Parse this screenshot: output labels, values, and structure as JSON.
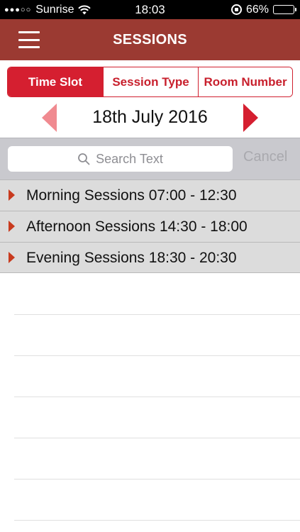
{
  "statusbar": {
    "signal_dots": "●●●○○",
    "carrier": "Sunrise",
    "time": "18:03",
    "battery_percent": "66%",
    "battery_level": 0.66
  },
  "navbar": {
    "title": "SESSIONS",
    "menu_icon": "hamburger-menu-icon"
  },
  "segments": [
    {
      "label": "Time Slot",
      "active": true
    },
    {
      "label": "Session Type",
      "active": false
    },
    {
      "label": "Room Number",
      "active": false
    }
  ],
  "date": {
    "label": "18th July 2016"
  },
  "search": {
    "placeholder": "Search Text",
    "cancel_label": "Cancel"
  },
  "sessions": [
    {
      "label": "Morning Sessions 07:00 - 12:30"
    },
    {
      "label": "Afternoon Sessions 14:30 - 18:00"
    },
    {
      "label": "Evening Sessions 18:30 - 20:30"
    }
  ],
  "colors": {
    "navbar_bg": "#9b3a32",
    "accent_red": "#d51f30",
    "prev_arrow_disabled": "#f08a90",
    "row_arrow": "#c83a1e",
    "row_bg": "#dcdcdc"
  }
}
